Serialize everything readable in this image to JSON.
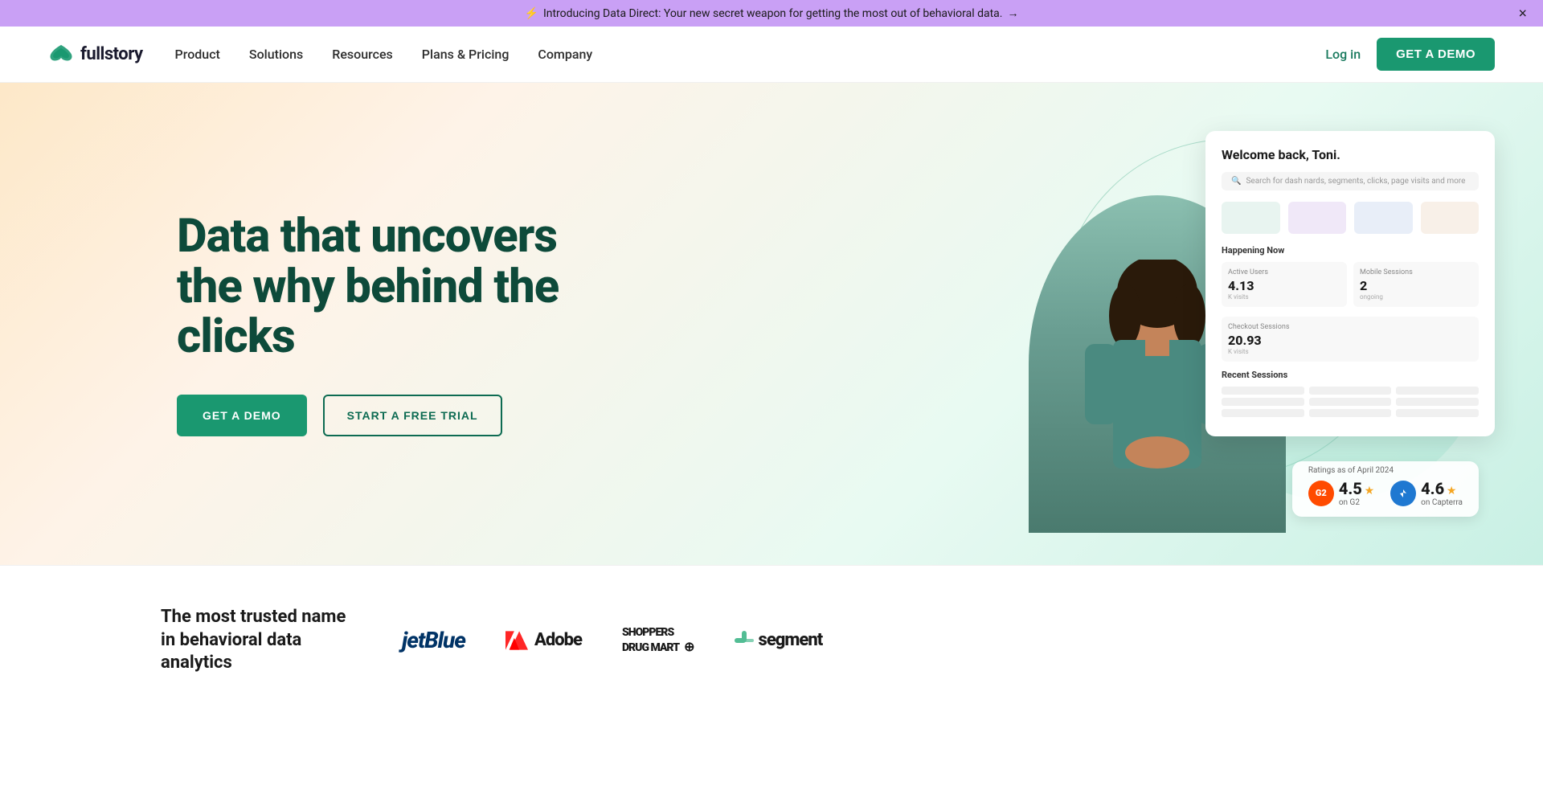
{
  "announcement": {
    "emoji": "⚡",
    "text": "Introducing Data Direct: Your new secret weapon for getting the most out of behavioral data.",
    "link_text": "→",
    "close_label": "×"
  },
  "nav": {
    "logo_text": "fullstory",
    "links": [
      {
        "label": "Product",
        "id": "product"
      },
      {
        "label": "Solutions",
        "id": "solutions"
      },
      {
        "label": "Resources",
        "id": "resources"
      },
      {
        "label": "Plans & Pricing",
        "id": "plans-pricing"
      },
      {
        "label": "Company",
        "id": "company"
      }
    ],
    "login_label": "Log in",
    "cta_label": "GET A DEMO"
  },
  "hero": {
    "title": "Data that uncovers the why behind the clicks",
    "cta_primary": "GET A DEMO",
    "cta_secondary": "START A FREE TRIAL",
    "dashboard": {
      "welcome": "Welcome back, Toni.",
      "search_placeholder": "Search for dash nards, segments, clicks, page visits and more",
      "happening_now_label": "Happening Now",
      "recent_sessions_label": "Recent Sessions",
      "metric1_label": "Active Users",
      "metric1_value": "4.13",
      "metric1_sub": "K visits",
      "metric2_label": "Mobile Sessions",
      "metric2_value": "2",
      "metric2_sub": "ongoing",
      "metric3_label": "Checkout Sessions",
      "metric3_value": "20.93",
      "metric3_sub": "K visits"
    },
    "ratings": {
      "label": "Ratings as of April 2024",
      "g2_score": "4.5",
      "g2_platform": "on G2",
      "capterra_score": "4.6",
      "capterra_platform": "on Capterra"
    }
  },
  "trusted": {
    "text": "The most trusted name in behavioral data analytics",
    "logos": [
      {
        "name": "JetBlue",
        "id": "jetblue",
        "text": "jetBlue"
      },
      {
        "name": "Adobe",
        "id": "adobe",
        "text": "Adobe"
      },
      {
        "name": "Shoppers Drug Mart",
        "id": "shoppers",
        "text": "SHOPPERS DRUG MART"
      },
      {
        "name": "Twilio Segment",
        "id": "segment",
        "text": "segment"
      }
    ]
  }
}
